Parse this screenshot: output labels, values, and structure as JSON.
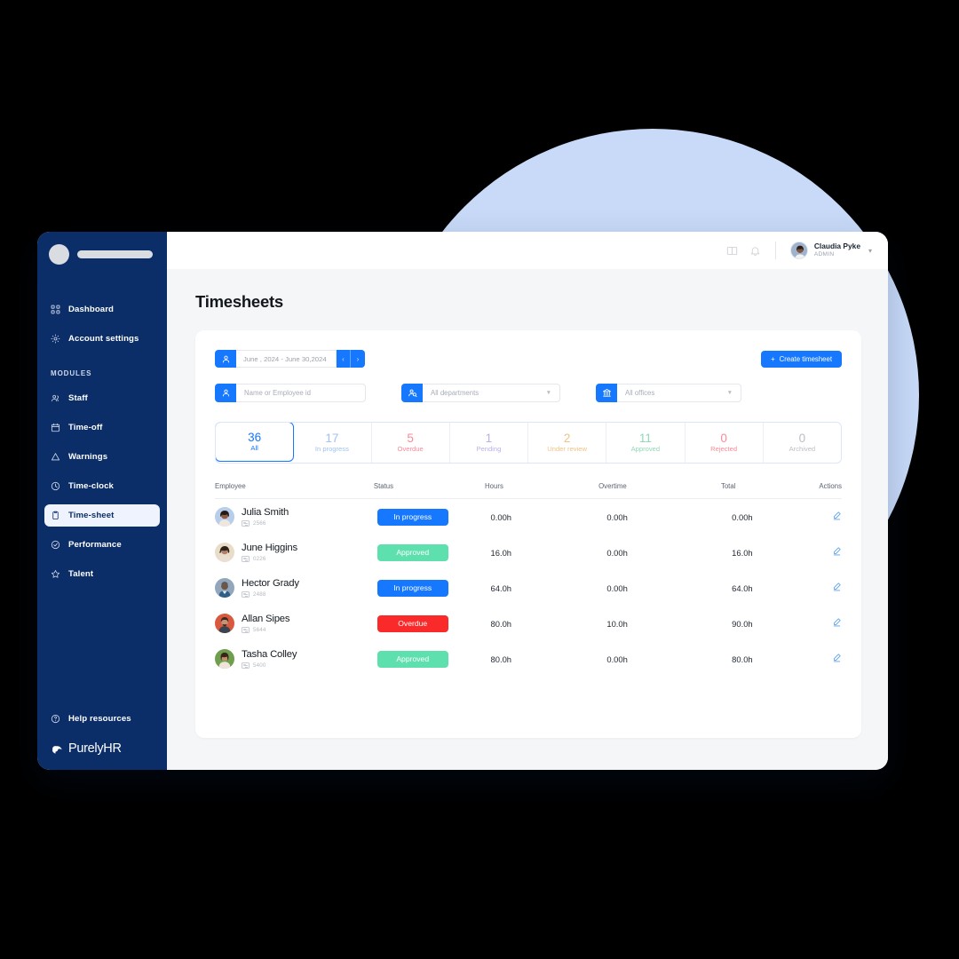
{
  "brand": {
    "name": "PurelyHR"
  },
  "sidebar": {
    "top_items": [
      {
        "label": "Dashboard",
        "icon": "grid-icon"
      },
      {
        "label": "Account settings",
        "icon": "gear-icon"
      }
    ],
    "group_label": "MODULES",
    "modules": [
      {
        "label": "Staff",
        "icon": "people-icon",
        "active": false
      },
      {
        "label": "Time-off",
        "icon": "calendar-icon",
        "active": false
      },
      {
        "label": "Warnings",
        "icon": "warning-triangle-icon",
        "active": false
      },
      {
        "label": "Time-clock",
        "icon": "clock-icon",
        "active": false
      },
      {
        "label": "Time-sheet",
        "icon": "document-icon",
        "active": true
      },
      {
        "label": "Performance",
        "icon": "check-circle-icon",
        "active": false
      },
      {
        "label": "Talent",
        "icon": "star-icon",
        "active": false
      }
    ],
    "help": {
      "label": "Help resources",
      "icon": "question-circle-icon"
    }
  },
  "topbar": {
    "icons": [
      "book-icon",
      "bell-icon"
    ],
    "user": {
      "name": "Claudia Pyke",
      "role": "ADMIN",
      "caret": "chevron-down-icon"
    }
  },
  "page": {
    "title": "Timesheets"
  },
  "filters": {
    "date_range": {
      "icon": "person-icon",
      "value": "June , 2024 - June 30,2024",
      "prev": "‹",
      "next": "›"
    },
    "create_button": {
      "label": "Create timesheet",
      "plus": "+"
    },
    "search": {
      "icon": "person-icon",
      "placeholder": "Name or Employee id"
    },
    "department": {
      "icon": "people-search-icon",
      "placeholder": "All departments",
      "caret": "▼"
    },
    "office": {
      "icon": "bank-icon",
      "placeholder": "All offices",
      "caret": "▼"
    }
  },
  "status_tabs": [
    {
      "count": "36",
      "label": "All",
      "color": "#1677ff",
      "active": true
    },
    {
      "count": "17",
      "label": "In progress",
      "color": "#9fc2f2",
      "active": false
    },
    {
      "count": "5",
      "label": "Overdue",
      "color": "#fa8a98",
      "active": false
    },
    {
      "count": "1",
      "label": "Pending",
      "color": "#b7b2ea",
      "active": false
    },
    {
      "count": "2",
      "label": "Under review",
      "color": "#edc487",
      "active": false
    },
    {
      "count": "11",
      "label": "Approved",
      "color": "#8fd9b6",
      "active": false
    },
    {
      "count": "0",
      "label": "Rejected",
      "color": "#fa8a98",
      "active": false
    },
    {
      "count": "0",
      "label": "Archived",
      "color": "#b9bec5",
      "active": false
    }
  ],
  "table": {
    "columns": [
      "Employee",
      "Status",
      "Hours",
      "Overtime",
      "Total",
      "Actions"
    ],
    "rows": [
      {
        "name": "Julia Smith",
        "id": "2566",
        "status": "In progress",
        "status_style": "blue",
        "hours": "0.00h",
        "overtime": "0.00h",
        "total": "0.00h",
        "action_icon": "edit-pencil-icon",
        "avatar_bg": "#b7cde9",
        "hair": "#241a15",
        "skin": "#8d5c42"
      },
      {
        "name": "June Higgins",
        "id": "0226",
        "status": "Approved",
        "status_style": "green",
        "hours": "16.0h",
        "overtime": "0.00h",
        "total": "16.0h",
        "action_icon": "edit-pencil-icon",
        "avatar_bg": "#e8ddc8",
        "hair": "#2e2118",
        "skin": "#b2806a"
      },
      {
        "name": "Hector Grady",
        "id": "2488",
        "status": "In progress",
        "status_style": "blue",
        "hours": "64.0h",
        "overtime": "0.00h",
        "total": "64.0h",
        "action_icon": "edit-pencil-icon",
        "avatar_bg": "#93a7bc",
        "hair": "#5b5b5b",
        "skin": "#6e5544"
      },
      {
        "name": "Allan Sipes",
        "id": "5644",
        "status": "Overdue",
        "status_style": "red",
        "hours": "80.0h",
        "overtime": "10.0h",
        "total": "90.0h",
        "action_icon": "edit-pencil-icon",
        "avatar_bg": "#d9593f",
        "hair": "#3a2a22",
        "skin": "#c79275"
      },
      {
        "name": "Tasha Colley",
        "id": "5400",
        "status": "Approved",
        "status_style": "green",
        "hours": "80.0h",
        "overtime": "0.00h",
        "total": "80.0h",
        "action_icon": "edit-pencil-icon",
        "avatar_bg": "#6f9e4e",
        "hair": "#3a2418",
        "skin": "#c08f6e"
      }
    ]
  },
  "theme": {
    "sidebar_bg": "#0b2e69",
    "accent": "#1677ff",
    "circle": "#c8daf8",
    "page_bg": "#f5f6f7"
  }
}
